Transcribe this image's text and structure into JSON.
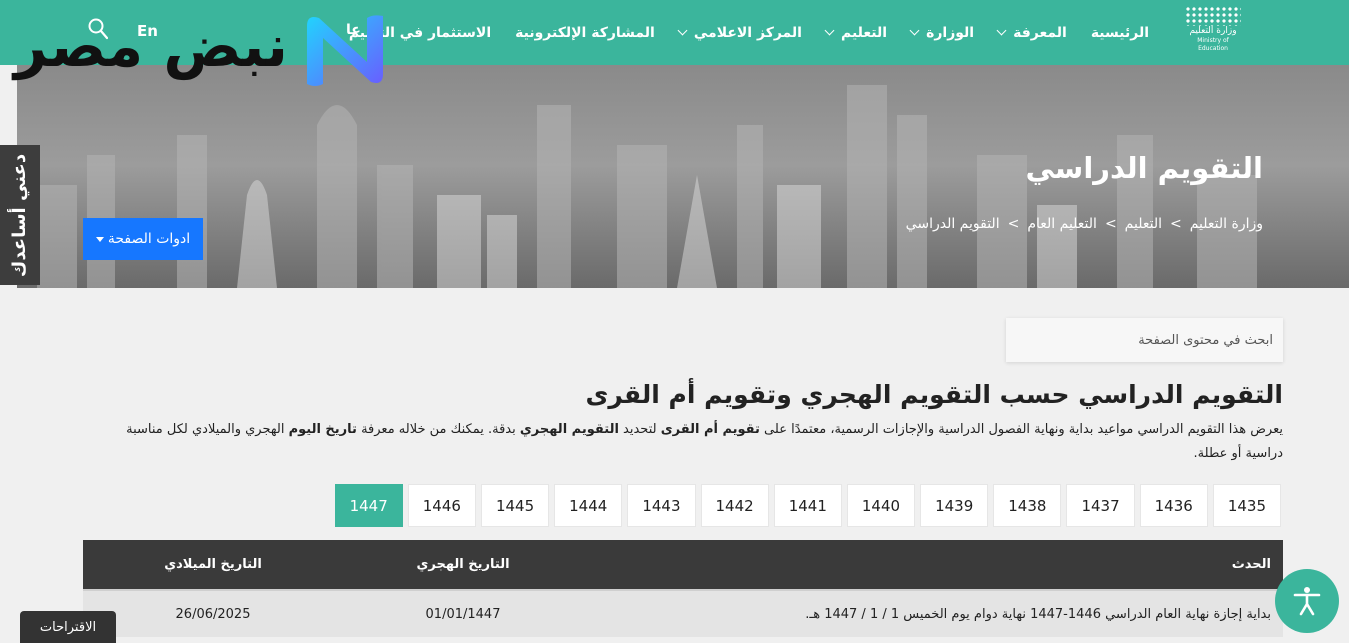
{
  "logo": {
    "text_ar": "وزارة التعليم",
    "text_en": "Ministry of Education"
  },
  "nav": {
    "items": [
      {
        "label": "الرئيسية",
        "dropdown": false
      },
      {
        "label": "المعرفة",
        "dropdown": true
      },
      {
        "label": "الوزارة",
        "dropdown": true
      },
      {
        "label": "التعليم",
        "dropdown": true
      },
      {
        "label": "المركز الاعلامي",
        "dropdown": true
      },
      {
        "label": "المشاركة الإلكترونية",
        "dropdown": false
      },
      {
        "label": "الاستثمار في التعليم",
        "dropdown": false
      }
    ],
    "extra": "عا",
    "language": "En"
  },
  "brand": {
    "text": "نبض مصر"
  },
  "hero": {
    "title": "التقويم الدراسي",
    "breadcrumb": [
      "وزارة التعليم",
      ">",
      "التعليم",
      ">",
      "التعليم العام",
      ">",
      "التقويم الدراسي"
    ],
    "tools_label": "ادوات الصفحة"
  },
  "help_tab": {
    "label": "دعني أساعدك"
  },
  "search": {
    "placeholder": "ابحث في محتوى الصفحة"
  },
  "section": {
    "title": "التقويم الدراسي حسب التقويم الهجري وتقويم أم القرى",
    "intro": {
      "p1": "يعرض هذا التقويم الدراسي مواعيد بداية ونهاية الفصول الدراسية والإجازات الرسمية، معتمدًا على ",
      "b1": "تقويم أم القرى",
      "p2": " لتحديد ",
      "b2": "التقويم الهجري",
      "p3": " بدقة. يمكنك من خلاله معرفة ",
      "b3": "تاريخ اليوم",
      "p4": " الهجري والميلادي لكل مناسبة دراسية أو عطلة."
    }
  },
  "years": {
    "items": [
      "1435",
      "1436",
      "1437",
      "1438",
      "1439",
      "1440",
      "1441",
      "1442",
      "1443",
      "1444",
      "1445",
      "1446",
      "1447"
    ],
    "active": "1447"
  },
  "table": {
    "headers": {
      "event": "الحدث",
      "hijri": "التاريخ الهجري",
      "gregorian": "التاريخ الميلادي"
    },
    "rows": [
      {
        "event": "بداية إجازة نهاية العام الدراسي 1446-1447 نهاية دوام يوم الخميس 1 / 1 / 1447 هـ.",
        "hijri": "01/01/1447",
        "gregorian": "26/06/2025"
      }
    ]
  },
  "suggestions": {
    "label": "الاقتراحات"
  },
  "colors": {
    "primary": "#3bb59c",
    "tools_button": "#1677ff",
    "table_header": "#3a3a3a"
  }
}
